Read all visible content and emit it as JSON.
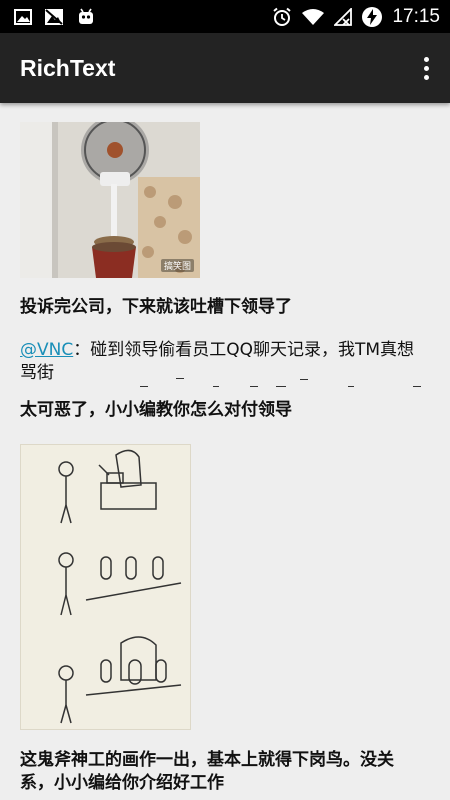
{
  "status_bar": {
    "time": "17:15",
    "left_icons": [
      "image-icon",
      "no-image-icon",
      "android-icon"
    ],
    "right_icons": [
      "alarm-icon",
      "wifi-icon",
      "signal-icon",
      "battery-charging-icon"
    ]
  },
  "app_bar": {
    "title": "RichText",
    "menu_icon": "overflow-menu-icon"
  },
  "content": {
    "image1": {
      "watermark": "搞笑图"
    },
    "para1": "投诉完公司，下来就该吐槽下领导了",
    "para2_mention": "@VNC",
    "para2_rest": "：碰到领导偷看员工QQ聊天记录，我TM真想骂街",
    "para3": "太可恶了，小小编教你怎么对付领导",
    "para4": "这鬼斧神工的画作一出，基本上就得下岗鸟。没关系，小小编给你介绍好工作"
  },
  "colors": {
    "status_bar": "#000000",
    "app_bar": "#232323",
    "background": "#eeeeee",
    "link": "#1a8fb8"
  }
}
